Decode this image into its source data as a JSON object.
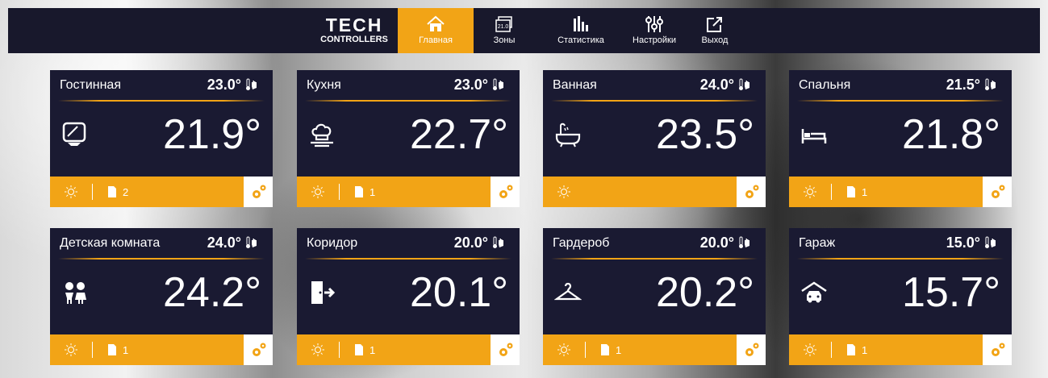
{
  "logo": {
    "line1": "TECH",
    "line2": "CONTROLLERS"
  },
  "nav": [
    {
      "label": "Главная",
      "icon": "home-icon",
      "active": true
    },
    {
      "label": "Зоны",
      "icon": "zones-icon",
      "badge": "21.0"
    },
    {
      "label": "Статистика",
      "icon": "statistics-icon"
    },
    {
      "label": "Настройки",
      "icon": "settings-sliders-icon"
    },
    {
      "label": "Выход",
      "icon": "exit-icon"
    }
  ],
  "cards": [
    {
      "name": "Гостинная",
      "set_temp": "23.0°",
      "current_temp": "21.9°",
      "icon": "tv-icon",
      "sensor_count": "2"
    },
    {
      "name": "Кухня",
      "set_temp": "23.0°",
      "current_temp": "22.7°",
      "icon": "chef-hat-icon",
      "sensor_count": "1"
    },
    {
      "name": "Ванная",
      "set_temp": "24.0°",
      "current_temp": "23.5°",
      "icon": "bathtub-icon",
      "sensor_count": ""
    },
    {
      "name": "Спальня",
      "set_temp": "21.5°",
      "current_temp": "21.8°",
      "icon": "bed-icon",
      "sensor_count": "1"
    },
    {
      "name": "Детская комната",
      "set_temp": "24.0°",
      "current_temp": "24.2°",
      "icon": "children-icon",
      "sensor_count": "1"
    },
    {
      "name": "Коридор",
      "set_temp": "20.0°",
      "current_temp": "20.1°",
      "icon": "door-icon",
      "sensor_count": "1"
    },
    {
      "name": "Гардероб",
      "set_temp": "20.0°",
      "current_temp": "20.2°",
      "icon": "hanger-icon",
      "sensor_count": "1"
    },
    {
      "name": "Гараж",
      "set_temp": "15.0°",
      "current_temp": "15.7°",
      "icon": "garage-icon",
      "sensor_count": "1"
    }
  ],
  "colors": {
    "accent": "#f2a416",
    "panel": "#1a1a32",
    "topbar": "#18182c"
  }
}
